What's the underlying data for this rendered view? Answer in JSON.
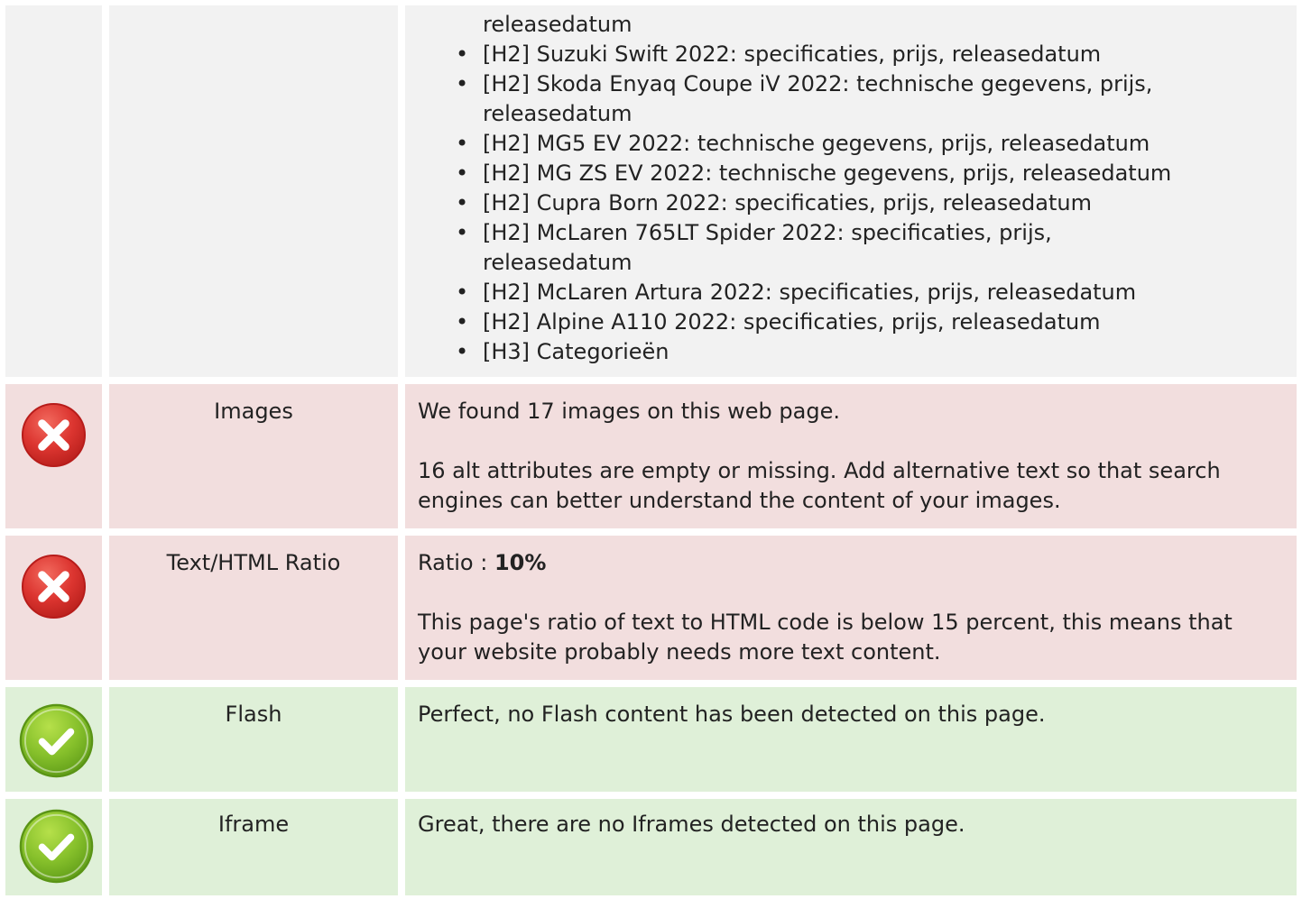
{
  "headings": {
    "items": [
      {
        "text": "releasedatum",
        "bullet": false
      },
      {
        "text": "[H2] Suzuki Swift 2022: specificaties, prijs, releasedatum",
        "bullet": true
      },
      {
        "text": "[H2] Skoda Enyaq Coupe iV 2022: technische gegevens, prijs,",
        "bullet": true
      },
      {
        "text": "releasedatum",
        "bullet": false
      },
      {
        "text": "[H2] MG5 EV 2022: technische gegevens, prijs, releasedatum",
        "bullet": true
      },
      {
        "text": "[H2] MG ZS EV 2022: technische gegevens, prijs, releasedatum",
        "bullet": true
      },
      {
        "text": "[H2] Cupra Born 2022: specificaties, prijs, releasedatum",
        "bullet": true
      },
      {
        "text": "[H2] McLaren 765LT Spider 2022: specificaties, prijs,",
        "bullet": true
      },
      {
        "text": "releasedatum",
        "bullet": false
      },
      {
        "text": "[H2] McLaren Artura 2022: specificaties, prijs, releasedatum",
        "bullet": true
      },
      {
        "text": "[H2] Alpine A110 2022: specificaties, prijs, releasedatum",
        "bullet": true
      },
      {
        "text": "[H3] Categorieën",
        "bullet": true
      }
    ]
  },
  "checks": {
    "images": {
      "status": "fail",
      "status_icon": "cross-icon",
      "label": "Images",
      "line1": "We found 17 images on this web page.",
      "line2": "16 alt attributes are empty or missing. Add alternative text so that search engines can better understand the content of your images."
    },
    "ratio": {
      "status": "fail",
      "status_icon": "cross-icon",
      "label": "Text/HTML Ratio",
      "ratio_prefix": "Ratio : ",
      "ratio_value": "10%",
      "line2": "This page's ratio of text to HTML code is below 15 percent, this means that your website probably needs more text content."
    },
    "flash": {
      "status": "pass",
      "status_icon": "check-icon",
      "label": "Flash",
      "line1": "Perfect, no Flash content has been detected on this page."
    },
    "iframe": {
      "status": "pass",
      "status_icon": "check-icon",
      "label": "Iframe",
      "line1": "Great, there are no Iframes detected on this page."
    }
  },
  "colors": {
    "fail_bg": "#f2dede",
    "pass_bg": "#dff0d8",
    "neutral_bg": "#f2f2f2",
    "fail_icon": "#d9312e",
    "pass_icon": "#7cb82a"
  }
}
